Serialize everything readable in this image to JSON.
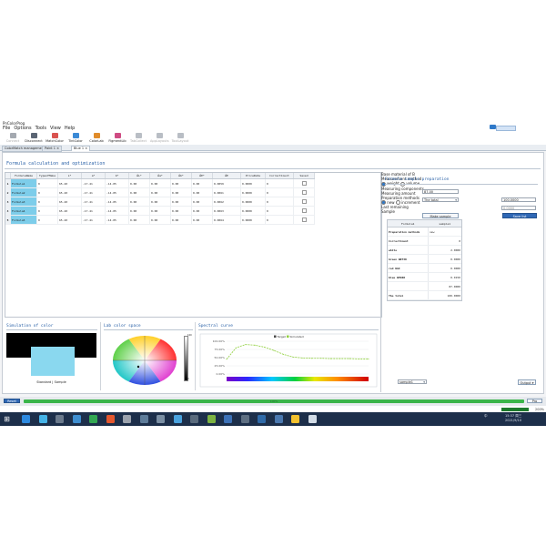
{
  "window": {
    "title": "PnColorProg"
  },
  "menu": [
    "File",
    "Options",
    "Tools",
    "View",
    "Help"
  ],
  "toolbar": [
    {
      "label": "Connect",
      "icon": "connect-icon",
      "color": "#a4a9b0",
      "enabled": false
    },
    {
      "label": "Disconnect",
      "icon": "disconnect-icon",
      "color": "#5b6574",
      "enabled": true
    },
    {
      "label": "MatchColor",
      "icon": "color-wheel-icon",
      "color": "#d9534f",
      "enabled": true
    },
    {
      "label": "TintColor",
      "icon": "tint-palette-icon",
      "color": "#3b8ad6",
      "enabled": true
    },
    {
      "label": "ColorLab",
      "icon": "lab-flask-icon",
      "color": "#e08c2b",
      "enabled": true
    },
    {
      "label": "FigmentLib",
      "icon": "pigment-library-icon",
      "color": "#cf4c83",
      "enabled": true
    },
    {
      "label": "TabCollect",
      "icon": "table-icon",
      "color": "#b9bec5",
      "enabled": false
    },
    {
      "label": "AppLayouts",
      "icon": "layout-icon",
      "color": "#b9bec5",
      "enabled": false
    },
    {
      "label": "ToolLayout",
      "icon": "tool-layout-icon",
      "color": "#b9bec5",
      "enabled": false
    }
  ],
  "tabs": [
    "ColorMatch management",
    "Paint 1",
    "Blue 1"
  ],
  "section_title": "Formula calculation and optimization",
  "grid": {
    "columns": [
      "FormulaName",
      "TypeofMake",
      "L*",
      "a*",
      "b*",
      "ΔL*",
      "Δa*",
      "Δb*",
      "ΔE*",
      "ΔE",
      "PriceRate",
      "CorrectCount",
      "Saved"
    ],
    "rows": [
      {
        "num": "1",
        "cells": [
          "Formula1",
          "0",
          "65.40",
          "-17.41",
          "-14.05",
          "0.00",
          "0.00",
          "0.00",
          "0.00",
          "0.0059",
          "0.0000",
          "0"
        ]
      },
      {
        "num": "2",
        "cells": [
          "Formula2",
          "0",
          "65.40",
          "-17.41",
          "-14.05",
          "0.00",
          "0.00",
          "0.00",
          "0.00",
          "0.0061",
          "0.0000",
          "0"
        ]
      },
      {
        "num": "3",
        "cells": [
          "Formula3",
          "0",
          "65.40",
          "-17.41",
          "-14.05",
          "0.00",
          "0.00",
          "0.00",
          "0.00",
          "0.0062",
          "0.0000",
          "0"
        ]
      },
      {
        "num": "4",
        "cells": [
          "Formula4",
          "0",
          "65.40",
          "-17.41",
          "-14.05",
          "0.00",
          "0.00",
          "0.00",
          "0.00",
          "0.0063",
          "0.0000",
          "0"
        ]
      },
      {
        "num": "5",
        "cells": [
          "Formula5",
          "0",
          "65.40",
          "-17.41",
          "-14.05",
          "0.00",
          "0.00",
          "0.00",
          "0.00",
          "0.0064",
          "0.0000",
          "0"
        ]
      }
    ]
  },
  "formula_panel": {
    "title": "Formula sample preparation",
    "base_label": "Base material of B",
    "base_value": "87.00",
    "measure_label": "Measurement method",
    "measure_options": [
      "weight",
      "volume"
    ],
    "measuring_label": "Measuring components",
    "measuring_value": "The total",
    "amount_label": "Measuring amount",
    "amount_value": "100.0000",
    "prep_label": "Preparation methods",
    "prep_options": [
      "new",
      "increment"
    ],
    "last_label": "Last remaining",
    "last_value": "0.0000",
    "make_btn": "Make sample",
    "save_btn": "Save list",
    "table_headers": [
      "Formula1",
      "sample1"
    ],
    "table_rows": [
      {
        "name": "Preparation methods",
        "value": "new"
      },
      {
        "name": "CorrectCount",
        "value": "0"
      },
      {
        "name": "white",
        "value": "2.0000"
      },
      {
        "name": "Green WRT30",
        "value": "0.0000"
      },
      {
        "name": "red UGI",
        "value": "0.0000"
      },
      {
        "name": "blue WP900",
        "value": "0.0150"
      },
      {
        "name": "",
        "value": "87.0000"
      },
      {
        "name": "The total",
        "value": "100.0000"
      }
    ],
    "sample_label": "Sample",
    "sample_value": "sample1",
    "output_btn": "Output"
  },
  "simulation": {
    "title": "Simulation of color",
    "caption": "Standard | Sample",
    "standard_color": "#000000",
    "sample_color": "#8ad8ef"
  },
  "lab": {
    "title": "Lab color space",
    "scale_top": "100",
    "scale_bottom": "0"
  },
  "spectral": {
    "title": "Spectral curve",
    "legend": [
      "Target",
      "Simulated"
    ]
  },
  "chart_data": {
    "type": "line",
    "title": "",
    "xlabel": "",
    "ylabel": "",
    "x": [
      400,
      420,
      440,
      460,
      480,
      500,
      520,
      540,
      560,
      580,
      600,
      620,
      640,
      660,
      680,
      700
    ],
    "series": [
      {
        "name": "Simulated",
        "values": [
          45,
          80,
          90,
          88,
          82,
          72,
          60,
          52,
          49,
          48,
          48,
          47,
          47,
          47,
          46,
          46
        ]
      }
    ],
    "ylim": [
      0,
      100
    ],
    "yticks": [
      "100.00%",
      "75.00%",
      "50.00%",
      "25.00%",
      "0.00%"
    ],
    "grid": true,
    "legend_position": "top"
  },
  "bottom": {
    "left_btn": "Reset",
    "progress_text": "100%",
    "right_btn": "Pro"
  },
  "taskbar": {
    "time": "15:37 周三",
    "date": "2021/9/10",
    "lang": "中",
    "zoom": "200%",
    "apps": [
      "#2d8ae0",
      "#45b3e7",
      "#6b7a8c",
      "#3e8ed0",
      "#33a852",
      "#e4572e",
      "#9ca3ad",
      "#5e7c99",
      "#7b8fa3",
      "#4aa3df",
      "#5a6b7d",
      "#7cb342",
      "#3d72b8",
      "#5e6f82",
      "#2f6aa8",
      "#4b79b0",
      "#f2c12e",
      "#d2dce6"
    ]
  }
}
